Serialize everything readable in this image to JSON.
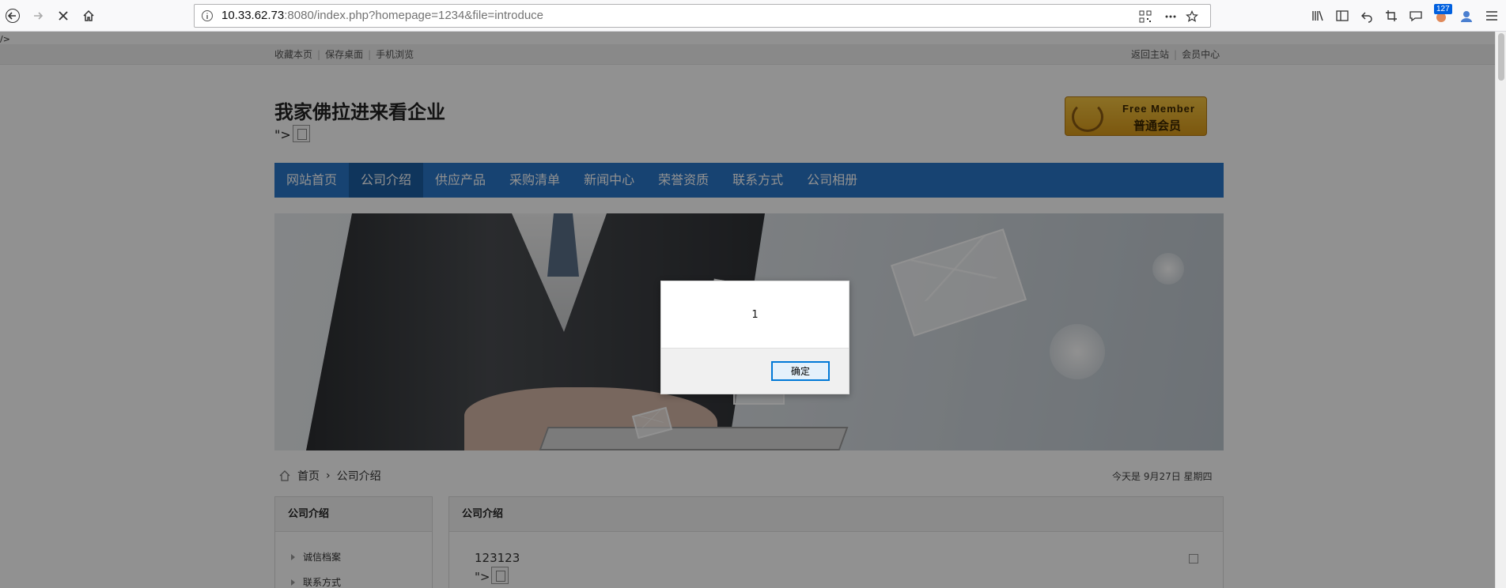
{
  "browser": {
    "url_host": "10.33.62.73",
    "url_rest": ":8080/index.php?homepage=1234&file=introduce",
    "badge_count": "127"
  },
  "page": {
    "stray_text": "/>",
    "topbar": {
      "left_links": [
        "收藏本页",
        "保存桌面",
        "手机浏览"
      ],
      "right_links": [
        "返回主站",
        "会员中心"
      ]
    },
    "site_title": "我家佛拉进来看企业",
    "title_tail": "\">",
    "member_badge": {
      "en": "Free Member",
      "zh": "普通会员"
    },
    "nav": [
      "网站首页",
      "公司介绍",
      "供应产品",
      "采购清单",
      "新闻中心",
      "荣誉资质",
      "联系方式",
      "公司相册"
    ],
    "nav_active_index": 1,
    "breadcrumb": {
      "home": "首页",
      "current": "公司介绍"
    },
    "date_text": "今天是 9月27日 星期四",
    "sidebar": {
      "title": "公司介绍",
      "items": [
        "诚信档案",
        "联系方式"
      ]
    },
    "content": {
      "title": "公司介绍",
      "text": "123123",
      "tail": "\">"
    }
  },
  "dialog": {
    "message": "1",
    "ok_label": "确定"
  },
  "colors": {
    "nav_bg": "#2a77c8",
    "nav_active": "#1c5ea3",
    "dialog_button_border": "#0078d7"
  }
}
